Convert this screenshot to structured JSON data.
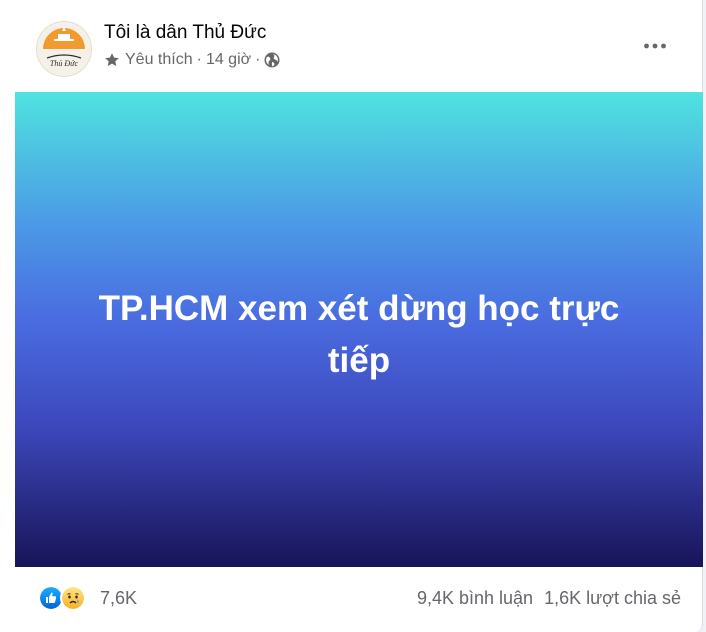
{
  "post": {
    "page_name": "Tôi là dân Thủ Đức",
    "meta": {
      "status": "Yêu thích",
      "separator": "·",
      "time": "14 giờ",
      "star_icon": "star-icon",
      "audience_icon": "globe-icon"
    },
    "more_icon": "more-dots-icon",
    "avatar_logo_text": "Thủ Đức",
    "banner": {
      "line1": "TP.HCM xem xét dừng học trực",
      "line2": "tiếp",
      "gradient_colors": [
        "#4fe3df",
        "#4b99e6",
        "#4a6ce0",
        "#3d48bd",
        "#181458"
      ]
    },
    "footer": {
      "reactions": [
        "like-reaction-icon",
        "sad-reaction-icon"
      ],
      "reaction_count": "7,6K",
      "comments": "9,4K bình luận",
      "shares": "1,6K lượt chia sẻ"
    }
  }
}
